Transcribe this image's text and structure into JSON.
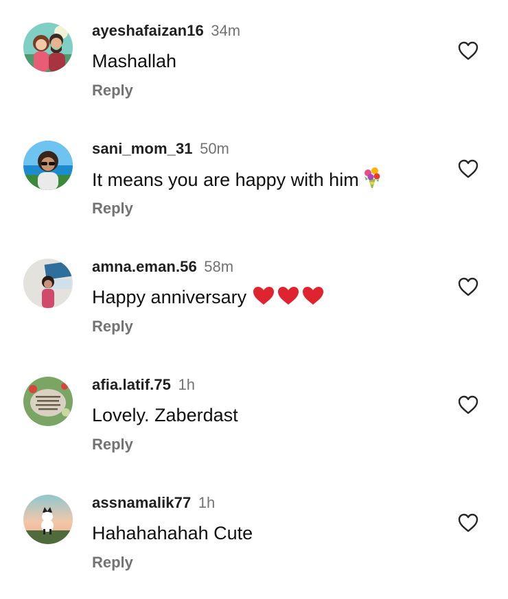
{
  "comments": [
    {
      "username": "ayeshafaizan16",
      "time": "34m",
      "text": "Mashallah",
      "emoji": "",
      "reply_label": "Reply",
      "avatar_icon": "cartoon-couple-avatar"
    },
    {
      "username": "sani_mom_31",
      "time": "50m",
      "text": "It means you are happy with him",
      "emoji": "bouquet",
      "reply_label": "Reply",
      "avatar_icon": "woman-sunglasses-avatar"
    },
    {
      "username": "amna.eman.56",
      "time": "58m",
      "text": "Happy anniversary",
      "emoji": "three-red-hearts",
      "reply_label": "Reply",
      "avatar_icon": "woman-photo-avatar"
    },
    {
      "username": "afia.latif.75",
      "time": "1h",
      "text": "Lovely. Zaberdast",
      "emoji": "",
      "reply_label": "Reply",
      "avatar_icon": "quote-stone-avatar"
    },
    {
      "username": "assnamalik77",
      "time": "1h",
      "text": "Hahahahahah Cute",
      "emoji": "",
      "reply_label": "Reply",
      "avatar_icon": "cat-sunset-avatar"
    }
  ],
  "colors": {
    "username": "#1f1f1f",
    "secondary": "#737373",
    "text": "#101010",
    "heart_emoji": "#e0242f"
  }
}
